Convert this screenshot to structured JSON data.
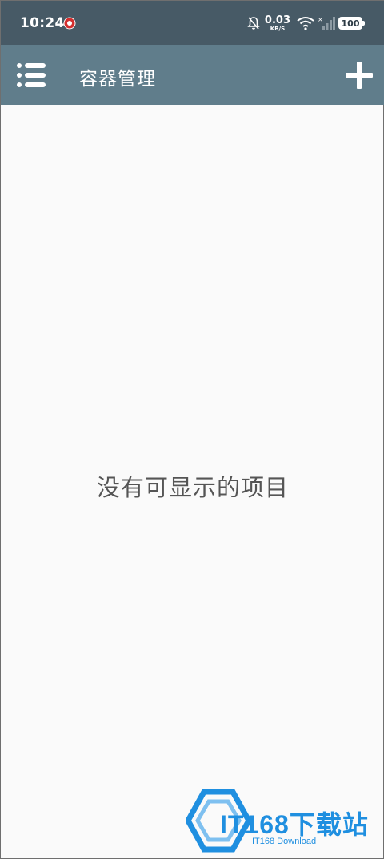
{
  "status_bar": {
    "time": "10:24",
    "net_speed_value": "0.03",
    "net_speed_unit": "KB/S",
    "battery": "100",
    "icons": [
      "notification-badge-icon",
      "bell-muted-icon",
      "wifi-icon",
      "signal-icon",
      "battery-icon"
    ]
  },
  "app_bar": {
    "title": "容器管理",
    "menu_icon": "menu-list-icon",
    "add_icon": "plus-icon"
  },
  "content": {
    "empty_message": "没有可显示的项目"
  },
  "watermark": {
    "main": "IT168下载站",
    "sub": "IT168 Download"
  },
  "colors": {
    "status_bar": "#475a66",
    "app_bar": "#607d8b",
    "background": "#fafafa",
    "watermark": "#1f8fe0"
  }
}
